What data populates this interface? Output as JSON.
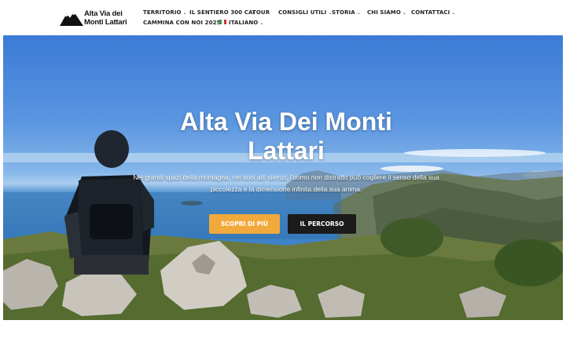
{
  "logo": {
    "line1": "Alta Via dei",
    "line2": "Monti Lattari"
  },
  "nav": {
    "items": [
      {
        "label": "TERRITORIO",
        "dropdown": true
      },
      {
        "label": "IL SENTIERO 300 CAI",
        "dropdown": false
      },
      {
        "label": "TOUR",
        "dropdown": false
      },
      {
        "label": "CONSIGLI UTILI",
        "dropdown": true
      },
      {
        "label": "STORIA",
        "dropdown": true
      },
      {
        "label": "CHI SIAMO",
        "dropdown": true
      },
      {
        "label": "CONTATTACI",
        "dropdown": true
      },
      {
        "label": "CAMMINA CON NOI 2025",
        "dropdown": false
      }
    ],
    "language": {
      "label": "ITALIANO",
      "icon": "italian-flag-icon"
    },
    "chevron": "⌄"
  },
  "hero": {
    "title": "Alta Via Dei Monti Lattari",
    "subtitle": "Nei grandi spazi della montagna, nei suoi alti silenzi, l'uomo non distratto può cogliere il senso della sua piccolezza e la dimensione infinita della sua anima.",
    "primary_button": "SCOPRI DI PIÙ",
    "secondary_button": "IL PERCORSO"
  },
  "colors": {
    "accent": "#f2a93b",
    "dark_button": "#1b1b1b",
    "nav_text": "#222222"
  }
}
